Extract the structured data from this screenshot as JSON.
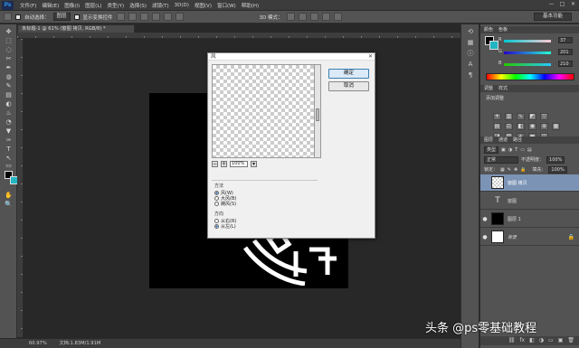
{
  "app": {
    "logo": "Ps"
  },
  "menu": [
    "文件(F)",
    "编辑(E)",
    "图像(I)",
    "图层(L)",
    "类型(Y)",
    "选择(S)",
    "滤镜(T)",
    "3D(D)",
    "视图(V)",
    "窗口(W)",
    "帮助(H)"
  ],
  "window_buttons": [
    "—",
    "□",
    "✕"
  ],
  "options_bar": {
    "auto_select_label": "自动选择：",
    "auto_select_value": "图层",
    "show_transform_label": "显示变换控件",
    "mode_label": "3D 模式：",
    "workspace": "基本功能"
  },
  "document": {
    "tab_title": "未标题-1 @ 61% (窗图 拷贝, RGB/8) *",
    "zoom": "60.97%",
    "doc_info": "文档:1.83M/1.91M"
  },
  "tools": [
    "✥",
    "⬚",
    "◌",
    "✂",
    "✒",
    "◍",
    "✎",
    "▤",
    "◐",
    "♨",
    "◔",
    "▼",
    "✑",
    "T",
    "↖",
    "▭",
    "✋",
    "🔍"
  ],
  "colors": {
    "foreground": "#000000",
    "background": "#21b5c3"
  },
  "right_panel": {
    "color_tabs": [
      "颜色",
      "色板"
    ],
    "sliders": [
      {
        "channel": "R",
        "value": "37"
      },
      {
        "channel": "G",
        "value": "201"
      },
      {
        "channel": "B",
        "value": "210"
      }
    ],
    "adjust_tabs": [
      "调整",
      "样式"
    ],
    "adjust_title": "添加调整",
    "layers_tabs": [
      "图层",
      "通道",
      "路径"
    ],
    "kind_label": "类型",
    "blend_mode": "正常",
    "opacity_label": "不透明度：",
    "opacity_value": "100%",
    "lock_label": "锁定：",
    "fill_label": "填充：",
    "fill_value": "100%",
    "layers": [
      {
        "name": "窗图 拷贝",
        "thumb": "checker",
        "selected": true,
        "eye": "",
        "lock": ""
      },
      {
        "name": "窗图",
        "thumb": "text",
        "selected": false,
        "eye": "",
        "lock": ""
      },
      {
        "name": "图层 1",
        "thumb": "black",
        "selected": false,
        "eye": "●",
        "lock": ""
      },
      {
        "name": "背景",
        "thumb": "white",
        "selected": false,
        "eye": "●",
        "lock": "🔒"
      }
    ],
    "footer_icons": [
      "⛓",
      "fx",
      "◧",
      "◑",
      "▭",
      "▣",
      "🗑"
    ]
  },
  "dialog": {
    "title": "风",
    "close": "✕",
    "ok": "确定",
    "cancel": "取消",
    "zoom_minus": "−",
    "zoom_value": "100%",
    "zoom_plus": "+",
    "method_title": "方法",
    "methods": [
      {
        "label": "风(W)",
        "checked": true
      },
      {
        "label": "大风(B)",
        "checked": false
      },
      {
        "label": "飓风(S)",
        "checked": false
      }
    ],
    "direction_title": "方向",
    "directions": [
      {
        "label": "从右(R)",
        "checked": false
      },
      {
        "label": "从左(L)",
        "checked": true
      }
    ]
  },
  "watermark": "头条 @ps零基础教程"
}
